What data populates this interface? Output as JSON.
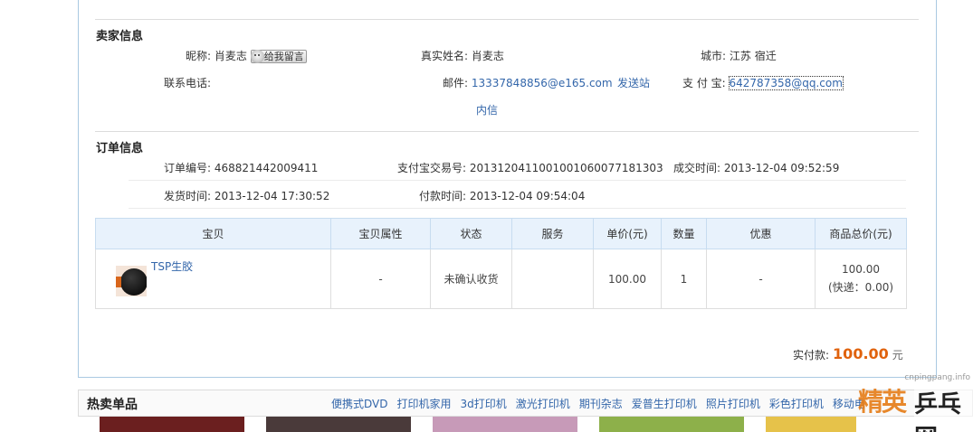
{
  "seller": {
    "title": "卖家信息",
    "nickname_label": "昵称:",
    "nickname": "肖麦志",
    "leave_msg": "给我留言",
    "realname_label": "真实姓名:",
    "realname": "肖麦志",
    "city_label": "城市:",
    "city": "江苏 宿迁",
    "phone_label": "联系电话:",
    "email_label": "邮件:",
    "email": "13337848856@e165.com",
    "send_msg_1": "发送站",
    "send_msg_2": "内信",
    "alipay_label": "支 付 宝:",
    "alipay": "642787358@qq.com"
  },
  "order": {
    "title": "订单信息",
    "order_no_label": "订单编号:",
    "order_no": "468821442009411",
    "trade_no_label": "支付宝交易号:",
    "trade_no": "2013120411001001060077181303",
    "deal_time_label": "成交时间:",
    "deal_time": "2013-12-04 09:52:59",
    "ship_time_label": "发货时间:",
    "ship_time": "2013-12-04 17:30:52",
    "pay_time_label": "付款时间:",
    "pay_time": "2013-12-04 09:54:04"
  },
  "table": {
    "headers": [
      "宝贝",
      "宝贝属性",
      "状态",
      "服务",
      "单价(元)",
      "数量",
      "优惠",
      "商品总价(元)"
    ],
    "row": {
      "name": "TSP生胶",
      "attr": "-",
      "status": "未确认收货",
      "service": "",
      "price": "100.00",
      "qty": "1",
      "discount": "-",
      "total": "100.00",
      "shipping": "(快递：0.00)"
    }
  },
  "summary": {
    "label": "实付款:",
    "amount": "100.00",
    "unit": "元"
  },
  "hot": {
    "title": "热卖单品",
    "links": [
      "便携式DVD",
      "打印机家用",
      "3d打印机",
      "激光打印机",
      "期刊杂志",
      "爱普生打印机",
      "照片打印机",
      "彩色打印机",
      "移动电"
    ]
  },
  "watermark": {
    "url": "cnpingpang.info",
    "big": "精英",
    "big2": "乒乓网"
  },
  "colors": {
    "link": "#3366aa",
    "accent": "#e0620d",
    "table_header": "#e8f2fc"
  }
}
